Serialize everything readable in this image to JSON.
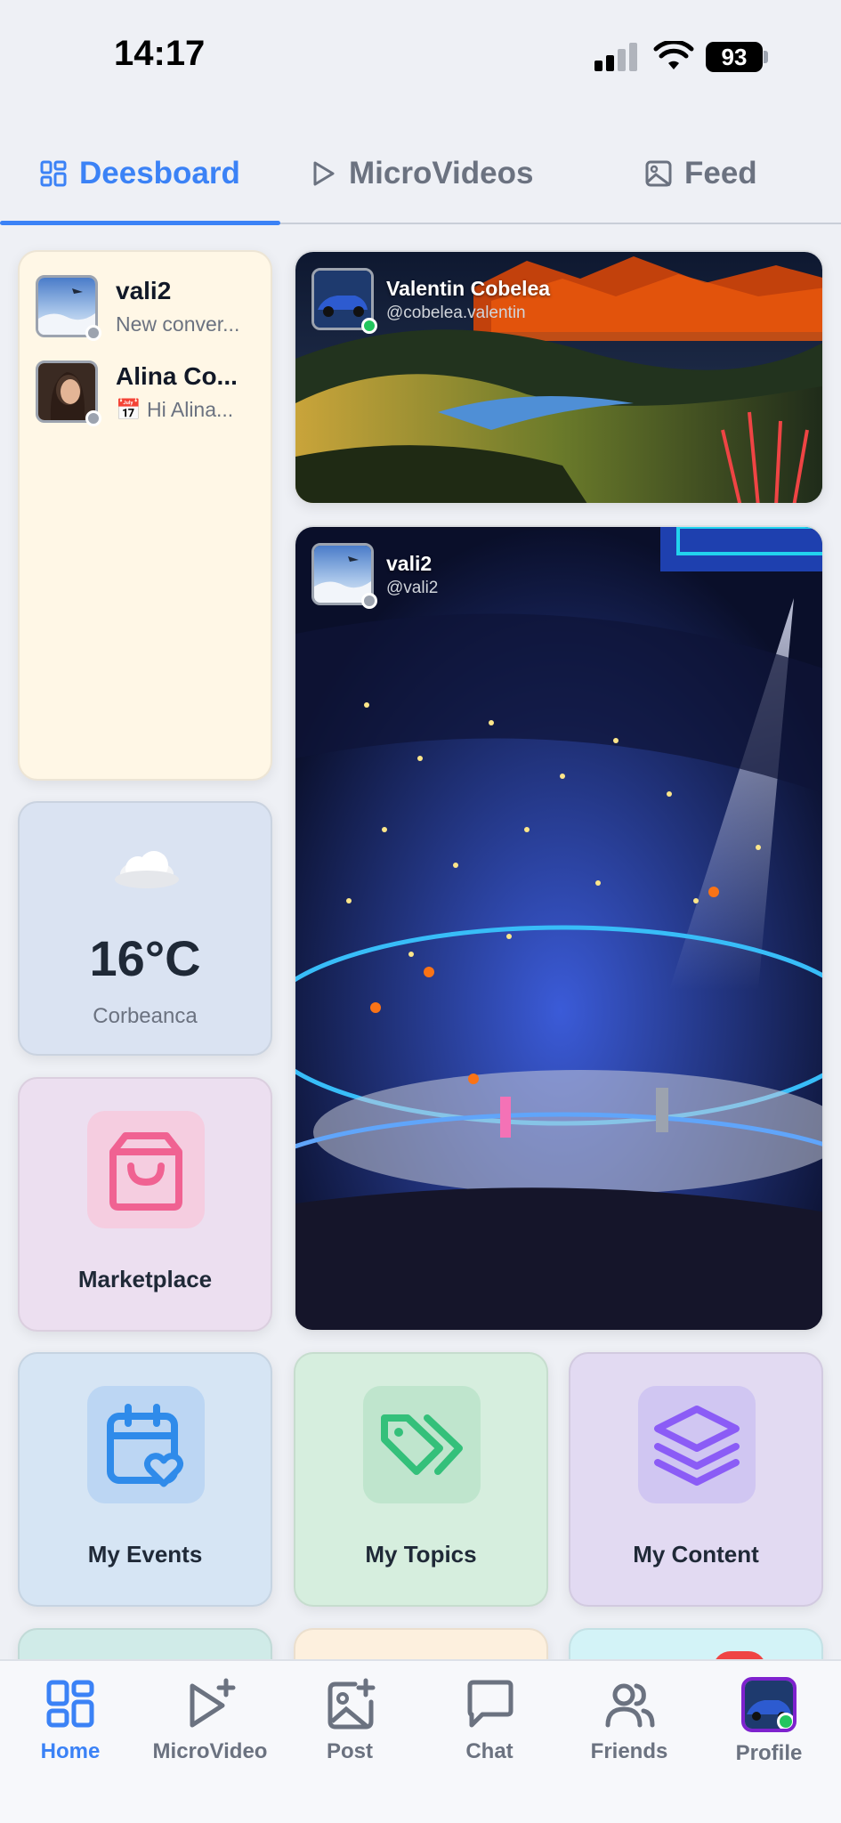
{
  "status_bar": {
    "time": "14:17",
    "battery": "93"
  },
  "tabs": [
    {
      "label": "Deesboard",
      "icon": "dashboard-icon",
      "active": true
    },
    {
      "label": "MicroVideos",
      "icon": "play-icon",
      "active": false
    },
    {
      "label": "Feed",
      "icon": "image-icon",
      "active": false
    }
  ],
  "chats": [
    {
      "name": "vali2",
      "message": "New conver..."
    },
    {
      "name": "Alina Co...",
      "message": "📅 Hi Alina..."
    }
  ],
  "weather": {
    "temperature": "16°C",
    "location": "Corbeanca",
    "icon": "cloud-icon"
  },
  "posts": [
    {
      "name": "Valentin Cobelea",
      "handle": "@cobelea.valentin",
      "online": true
    },
    {
      "name": "vali2",
      "handle": "@vali2",
      "online": false
    }
  ],
  "tiles": {
    "marketplace": "Marketplace",
    "events": "My Events",
    "topics": "My Topics",
    "content": "My Content"
  },
  "bottom_nav": [
    {
      "label": "Home",
      "icon": "home-grid-icon",
      "active": true
    },
    {
      "label": "MicroVideo",
      "icon": "video-plus-icon",
      "active": false
    },
    {
      "label": "Post",
      "icon": "image-plus-icon",
      "active": false
    },
    {
      "label": "Chat",
      "icon": "chat-bubble-icon",
      "active": false
    },
    {
      "label": "Friends",
      "icon": "friends-icon",
      "active": false
    },
    {
      "label": "Profile",
      "icon": "profile-avatar-icon",
      "active": false
    }
  ],
  "colors": {
    "accent": "#3b82f6",
    "online": "#22c55e",
    "offline": "#9ca3af",
    "marketplace_icon": "#f06292",
    "events_icon": "#2f8bea",
    "topics_icon": "#34c07a",
    "content_icon": "#8b5cf6"
  }
}
